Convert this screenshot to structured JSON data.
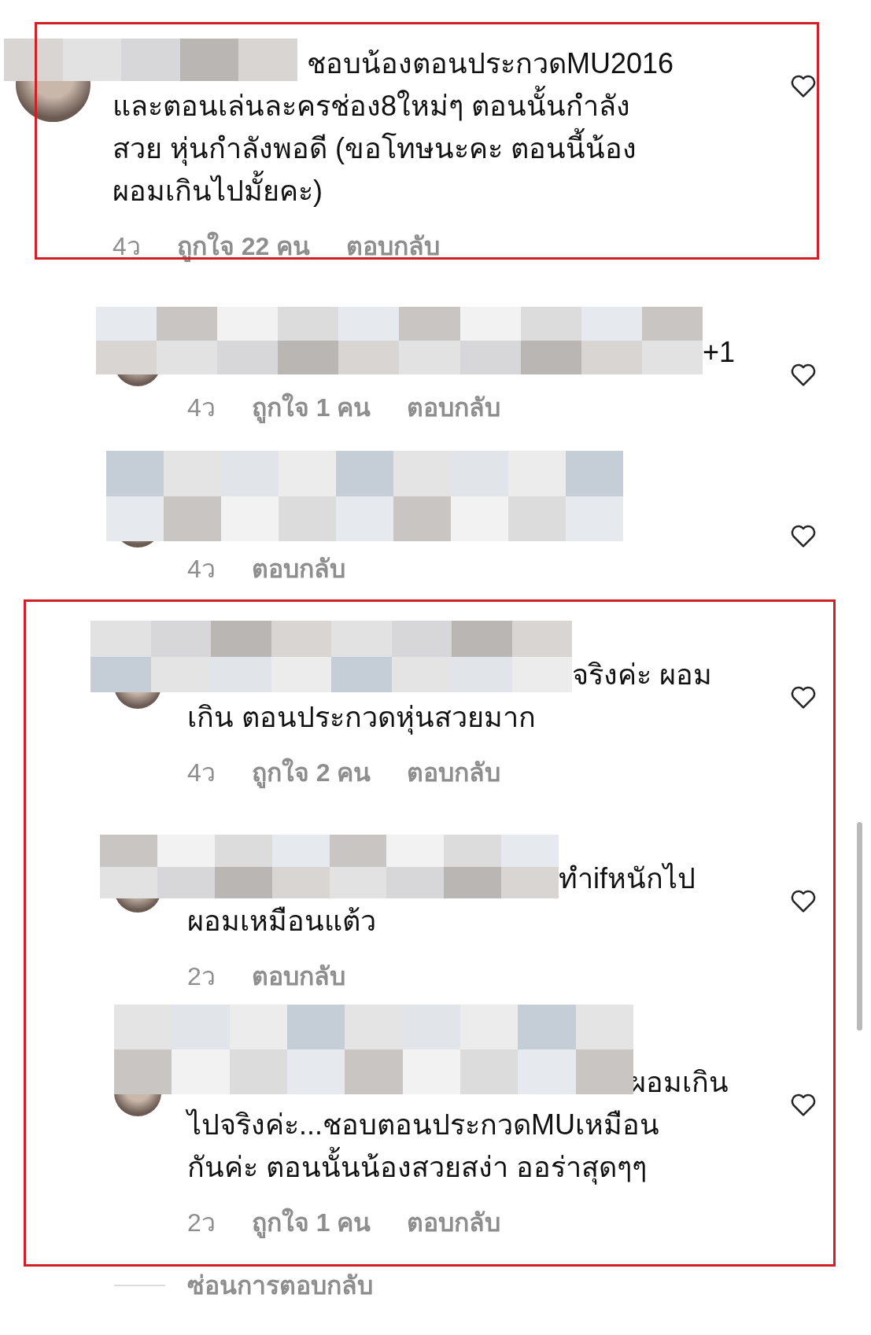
{
  "comments": [
    {
      "kind": "comment",
      "lines": [
        "ชอบน้องตอนประกวดMU2016",
        "และตอนเล่นละครช่อง8ใหม่ๆ ตอนนั้นกำลัง",
        "สวย หุ่นกำลังพอดี (ขอโทษนะคะ ตอนนี้น้อง",
        "ผอมเกินไปมั้ยคะ)"
      ],
      "time": "4ว",
      "likes": "ถูกใจ 22 คน",
      "reply": "ตอบกลับ"
    },
    {
      "kind": "reply",
      "lines": [
        "+1"
      ],
      "time": "4ว",
      "likes": "ถูกใจ 1 คน",
      "reply": "ตอบกลับ"
    },
    {
      "kind": "reply",
      "time": "4ว",
      "reply": "ตอบกลับ"
    },
    {
      "kind": "reply",
      "lines": [
        "จริงค่ะ ผอม",
        "เกิน ตอนประกวดหุ่นสวยมาก"
      ],
      "time": "4ว",
      "likes": "ถูกใจ 2 คน",
      "reply": "ตอบกลับ"
    },
    {
      "kind": "reply",
      "lines": [
        "ทำifหนักไป",
        "ผอมเหมือนแต้ว"
      ],
      "time": "2ว",
      "reply": "ตอบกลับ"
    },
    {
      "kind": "reply",
      "lines": [
        "ผอมเกิน",
        "ไปจริงค่ะ...ชอบตอนประกวดMUเหมือน",
        "กันค่ะ ตอนนั้นน้องสวยสง่า ออร่าสุดๆๆ"
      ],
      "time": "2ว",
      "likes": "ถูกใจ 1 คน",
      "reply": "ตอบกลับ"
    }
  ],
  "hide_replies": "ซ่อนการตอบกลับ"
}
